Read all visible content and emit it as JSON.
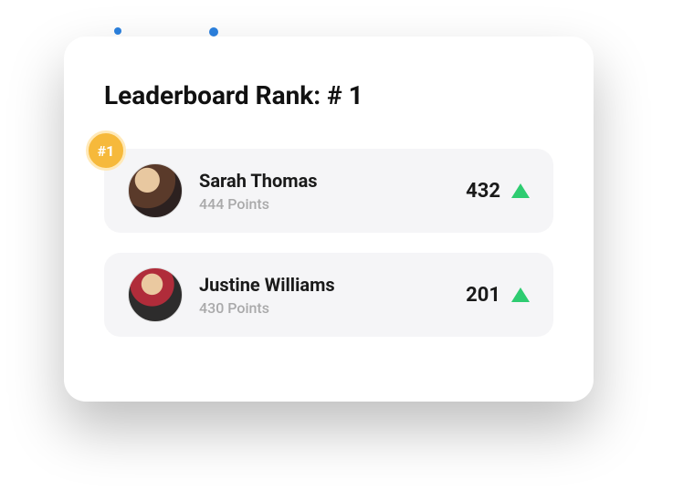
{
  "title": "Leaderboard Rank: # 1",
  "badge": "#1",
  "rows": [
    {
      "name": "Sarah Thomas",
      "points": "444 Points",
      "score": "432"
    },
    {
      "name": "Justine Williams",
      "points": "430 Points",
      "score": "201"
    }
  ]
}
